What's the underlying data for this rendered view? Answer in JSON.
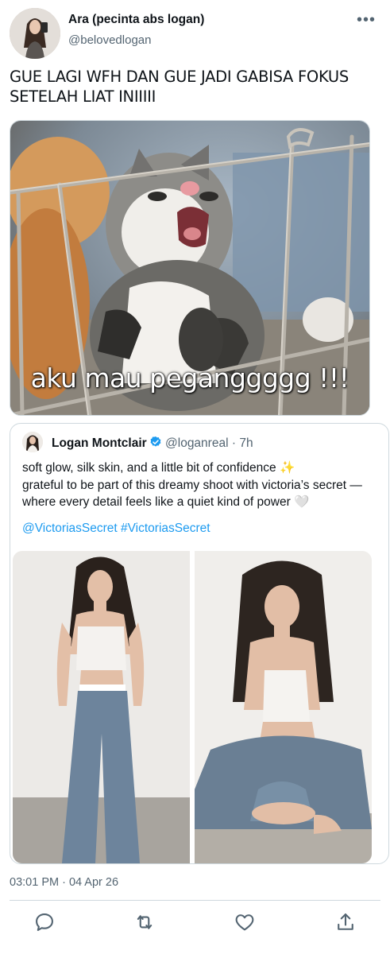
{
  "author": {
    "name": "Ara (pecinta abs logan)",
    "handle": "@belovedlogan"
  },
  "tweet": {
    "text": "GUE LAGI WFH DAN GUE JADI GABISA FOKUS SETELAH LIAT INIIIII",
    "media_caption": "aku mau peganggggg !!!"
  },
  "quoted": {
    "name": "Logan Montclair",
    "handle": "@loganreal",
    "separator": "·",
    "time": "7h",
    "lines": [
      "soft glow, silk skin, and a little bit of confidence ✨",
      "grateful to be part of this dreamy shoot with victoria’s secret —",
      "where every detail feels like a quiet kind of power 🤍"
    ],
    "mentions": [
      "@VictoriasSecret",
      "#VictoriasSecret"
    ]
  },
  "timestamp": "03:01 PM · 04 Apr 26",
  "icons": {
    "more": "more-horizontal-icon",
    "verified": "verified-badge-icon",
    "reply": "reply-icon",
    "retweet": "retweet-icon",
    "like": "heart-icon",
    "share": "share-icon"
  },
  "colors": {
    "accent": "#1d9bf0",
    "secondary_text": "#536471",
    "border": "#cfd9de"
  }
}
